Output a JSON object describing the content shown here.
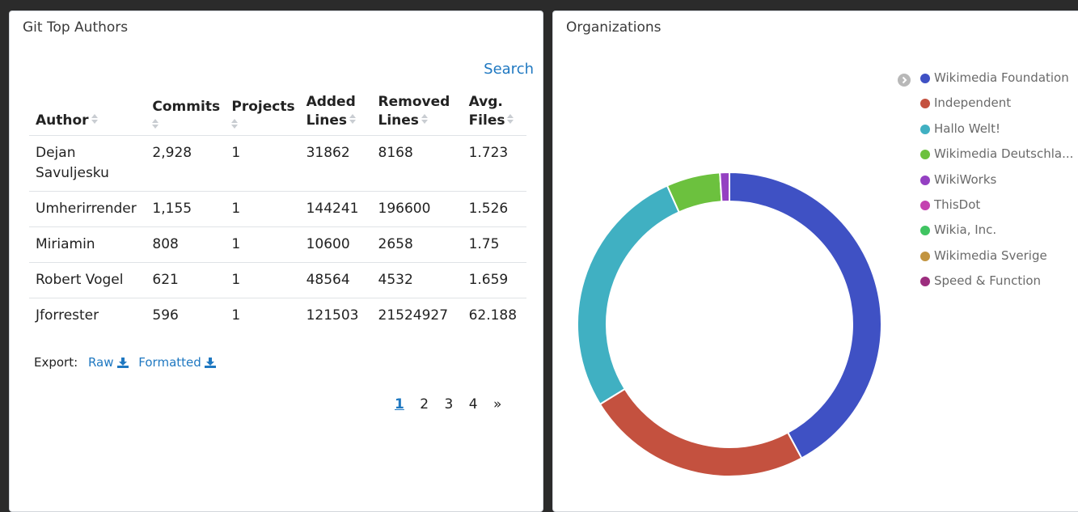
{
  "left_panel": {
    "title": "Git Top Authors",
    "search_label": "Search",
    "columns": [
      {
        "line1": "Author",
        "line2": ""
      },
      {
        "line1": "Commits",
        "line2": ""
      },
      {
        "line1": "Projects",
        "line2": ""
      },
      {
        "line1": "Added",
        "line2": "Lines"
      },
      {
        "line1": "Removed",
        "line2": "Lines"
      },
      {
        "line1": "Avg.",
        "line2": "Files"
      }
    ],
    "rows": [
      {
        "author": "Dejan Savuljesku",
        "commits": "2,928",
        "projects": "1",
        "added": "31862",
        "removed": "8168",
        "avg_files": "1.723"
      },
      {
        "author": "Umherirrender",
        "commits": "1,155",
        "projects": "1",
        "added": "144241",
        "removed": "196600",
        "avg_files": "1.526"
      },
      {
        "author": "Miriamin",
        "commits": "808",
        "projects": "1",
        "added": "10600",
        "removed": "2658",
        "avg_files": "1.75"
      },
      {
        "author": "Robert Vogel",
        "commits": "621",
        "projects": "1",
        "added": "48564",
        "removed": "4532",
        "avg_files": "1.659"
      },
      {
        "author": "Jforrester",
        "commits": "596",
        "projects": "1",
        "added": "121503",
        "removed": "21524927",
        "avg_files": "62.188"
      }
    ],
    "export": {
      "label": "Export:",
      "raw": "Raw",
      "formatted": "Formatted"
    },
    "pagination": {
      "pages": [
        "1",
        "2",
        "3",
        "4"
      ],
      "next": "»",
      "active": "1"
    }
  },
  "right_panel": {
    "title": "Organizations",
    "legend_items": [
      {
        "label": "Wikimedia Foundation",
        "color": "#3f51c4"
      },
      {
        "label": "Independent",
        "color": "#c4513f"
      },
      {
        "label": "Hallo Welt!",
        "color": "#40b0c2"
      },
      {
        "label": "Wikimedia Deutschla...",
        "color": "#6cc13e"
      },
      {
        "label": "WikiWorks",
        "color": "#9440c2"
      },
      {
        "label": "ThisDot",
        "color": "#c442b0"
      },
      {
        "label": "Wikia, Inc.",
        "color": "#3fc461"
      },
      {
        "label": "Wikimedia Sverige",
        "color": "#c29440"
      },
      {
        "label": "Speed & Function",
        "color": "#9c2d7e"
      }
    ],
    "chart_data": {
      "type": "pie",
      "categories": [
        "Wikimedia Foundation",
        "Independent",
        "Hallo Welt!",
        "Wikimedia Deutschla...",
        "WikiWorks"
      ],
      "values": [
        42,
        24,
        27,
        5.7,
        1.0
      ],
      "colors": [
        "#3f51c4",
        "#c4513f",
        "#40b0c2",
        "#6cc13e",
        "#9440c2"
      ]
    }
  }
}
